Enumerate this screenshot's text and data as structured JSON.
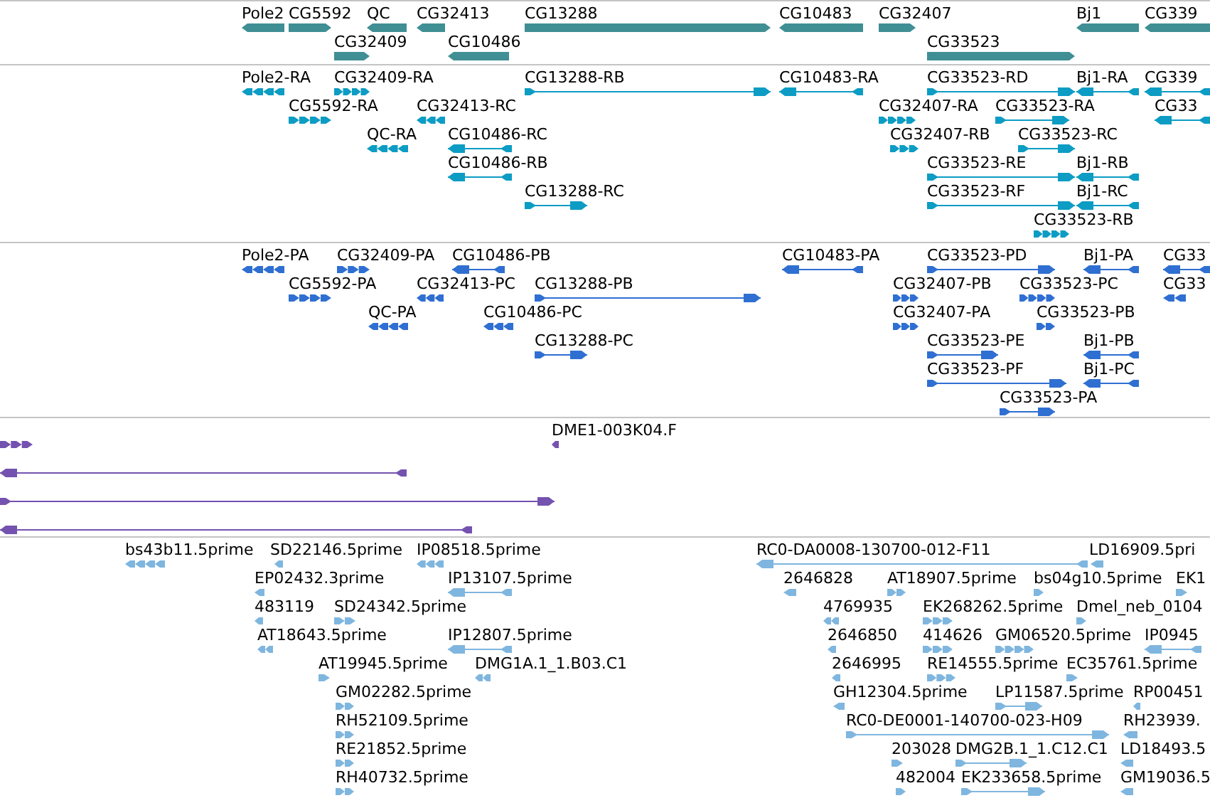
{
  "tracks": [
    {
      "kind": "gene",
      "color": "#3f8f94",
      "features": [
        {
          "label": "Pole2",
          "reverse": true
        },
        {
          "label": "CG5592",
          "reverse": false
        },
        {
          "label": "QC",
          "reverse": true
        },
        {
          "label": "CG32413",
          "reverse": true
        },
        {
          "label": "CG13288",
          "reverse": false
        },
        {
          "label": "CG10483",
          "reverse": true
        },
        {
          "label": "CG32407",
          "reverse": false
        },
        {
          "label": "Bj1",
          "reverse": true
        },
        {
          "label": "CG339",
          "reverse": true
        },
        {
          "label": "CG32409",
          "reverse": false
        },
        {
          "label": "CG10486",
          "reverse": true
        },
        {
          "label": "CG33523",
          "reverse": false
        }
      ]
    },
    {
      "kind": "transcript",
      "color": "#0c9cc4",
      "features": [
        {
          "label": "Pole2-RA",
          "reverse": true
        },
        {
          "label": "CG32409-RA",
          "reverse": false
        },
        {
          "label": "CG13288-RB",
          "reverse": false
        },
        {
          "label": "CG10483-RA",
          "reverse": true
        },
        {
          "label": "CG33523-RD",
          "reverse": false
        },
        {
          "label": "Bj1-RA",
          "reverse": true
        },
        {
          "label": "CG339",
          "reverse": true
        },
        {
          "label": "CG5592-RA",
          "reverse": false
        },
        {
          "label": "CG32413-RC",
          "reverse": true
        },
        {
          "label": "CG32407-RA",
          "reverse": false
        },
        {
          "label": "CG33523-RA",
          "reverse": false
        },
        {
          "label": "CG33",
          "reverse": true
        },
        {
          "label": "QC-RA",
          "reverse": true
        },
        {
          "label": "CG10486-RC",
          "reverse": true
        },
        {
          "label": "CG32407-RB",
          "reverse": false
        },
        {
          "label": "CG33523-RC",
          "reverse": false
        },
        {
          "label": "CG10486-RB",
          "reverse": true
        },
        {
          "label": "CG33523-RE",
          "reverse": false
        },
        {
          "label": "Bj1-RB",
          "reverse": true
        },
        {
          "label": "CG13288-RC",
          "reverse": false
        },
        {
          "label": "CG33523-RF",
          "reverse": false
        },
        {
          "label": "Bj1-RC",
          "reverse": true
        },
        {
          "label": "CG33523-RB",
          "reverse": false
        }
      ]
    },
    {
      "kind": "transcript",
      "color": "#2f6fd2",
      "features": [
        {
          "label": "Pole2-PA",
          "reverse": true
        },
        {
          "label": "CG32409-PA",
          "reverse": false
        },
        {
          "label": "CG10486-PB",
          "reverse": true
        },
        {
          "label": "CG10483-PA",
          "reverse": true
        },
        {
          "label": "CG33523-PD",
          "reverse": false
        },
        {
          "label": "Bj1-PA",
          "reverse": true
        },
        {
          "label": "CG33",
          "reverse": true
        },
        {
          "label": "CG5592-PA",
          "reverse": false
        },
        {
          "label": "CG32413-PC",
          "reverse": true
        },
        {
          "label": "CG13288-PB",
          "reverse": false
        },
        {
          "label": "CG32407-PB",
          "reverse": false
        },
        {
          "label": "CG33523-PC",
          "reverse": false
        },
        {
          "label": "CG33",
          "reverse": true
        },
        {
          "label": "QC-PA",
          "reverse": true
        },
        {
          "label": "CG10486-PC",
          "reverse": true
        },
        {
          "label": "CG32407-PA",
          "reverse": false
        },
        {
          "label": "CG33523-PB",
          "reverse": false
        },
        {
          "label": "CG13288-PC",
          "reverse": false
        },
        {
          "label": "CG33523-PE",
          "reverse": false
        },
        {
          "label": "Bj1-PB",
          "reverse": true
        },
        {
          "label": "CG33523-PF",
          "reverse": false
        },
        {
          "label": "Bj1-PC",
          "reverse": true
        },
        {
          "label": "CG33523-PA",
          "reverse": false
        }
      ]
    },
    {
      "kind": "alignment",
      "color": "#7452b0",
      "features": [
        {
          "label": "DME1-003K04.F",
          "reverse": true
        },
        {
          "reverse": false
        },
        {
          "reverse": true
        },
        {
          "reverse": false
        },
        {
          "reverse": true
        }
      ]
    },
    {
      "kind": "alignment",
      "color": "#7fb6df",
      "features": [
        {
          "label": "bs43b11.5prime",
          "reverse": true
        },
        {
          "label": "SD22146.5prime",
          "reverse": true
        },
        {
          "label": "IP08518.5prime",
          "reverse": true
        },
        {
          "label": "RC0-DA0008-130700-012-F11",
          "reverse": true
        },
        {
          "label": "LD16909.5pri",
          "reverse": true
        },
        {
          "label": "EP02432.3prime",
          "reverse": true
        },
        {
          "label": "IP13107.5prime",
          "reverse": true
        },
        {
          "label": "2646828",
          "reverse": true
        },
        {
          "label": "AT18907.5prime",
          "reverse": false
        },
        {
          "label": "bs04g10.5prime",
          "reverse": false
        },
        {
          "label": "EK1",
          "reverse": false
        },
        {
          "label": "483119",
          "reverse": true
        },
        {
          "label": "SD24342.5prime",
          "reverse": false
        },
        {
          "label": "4769935",
          "reverse": true
        },
        {
          "label": "EK268262.5prime",
          "reverse": false
        },
        {
          "label": "Dmel_neb_0104",
          "reverse": false
        },
        {
          "label": "AT18643.5prime",
          "reverse": true
        },
        {
          "label": "IP12807.5prime",
          "reverse": true
        },
        {
          "label": "2646850",
          "reverse": true
        },
        {
          "label": "414626",
          "reverse": false
        },
        {
          "label": "GM06520.5prime",
          "reverse": false
        },
        {
          "label": "IP0945",
          "reverse": true
        },
        {
          "label": "AT19945.5prime",
          "reverse": false
        },
        {
          "label": "DMG1A.1_1.B03.C1",
          "reverse": true
        },
        {
          "label": "2646995",
          "reverse": true
        },
        {
          "label": "RE14555.5prime",
          "reverse": false
        },
        {
          "label": "EC35761.5prime",
          "reverse": false
        },
        {
          "label": "GM02282.5prime",
          "reverse": false
        },
        {
          "label": "GH12304.5prime",
          "reverse": true
        },
        {
          "label": "LP11587.5prime",
          "reverse": false
        },
        {
          "label": "RP00451",
          "reverse": true
        },
        {
          "label": "RH52109.5prime",
          "reverse": false
        },
        {
          "label": "RC0-DE0001-140700-023-H09",
          "reverse": false
        },
        {
          "label": "RH23939.",
          "reverse": true
        },
        {
          "label": "RE21852.5prime",
          "reverse": false
        },
        {
          "label": "203028",
          "reverse": false
        },
        {
          "label": "DMG2B.1_1.C12.C1",
          "reverse": false
        },
        {
          "label": "LD18493.5",
          "reverse": true
        },
        {
          "label": "RH40732.5prime",
          "reverse": false
        },
        {
          "label": "482004",
          "reverse": false
        },
        {
          "label": "EK233658.5prime",
          "reverse": false
        },
        {
          "label": "GM19036.5",
          "reverse": true
        }
      ]
    }
  ]
}
